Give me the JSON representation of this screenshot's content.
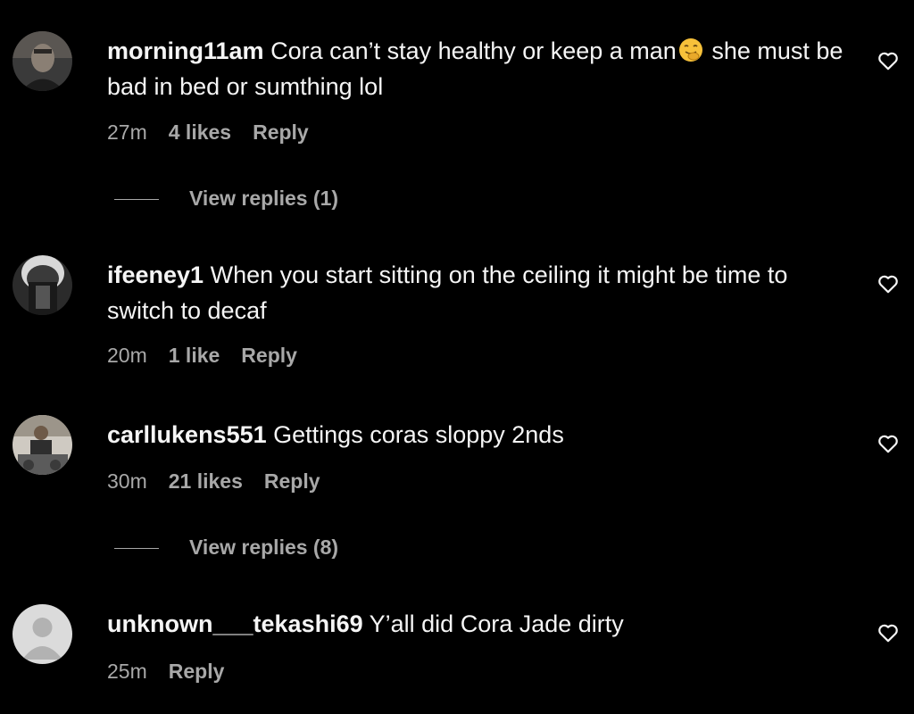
{
  "comments": [
    {
      "username": "morning11am",
      "text_before_emoji": "Cora can’t stay healthy or keep a man",
      "emoji": "face-with-hand-over-mouth-icon",
      "text_after_emoji": "she must be bad in bed or sumthing lol",
      "time": "27m",
      "likes": "4 likes",
      "reply": "Reply",
      "view_replies": "View replies (1)"
    },
    {
      "username": "ifeeney1",
      "text": "When you start sitting on the ceiling it might be time to switch to decaf",
      "time": "20m",
      "likes": "1 like",
      "reply": "Reply"
    },
    {
      "username": "carllukens551",
      "text": "Gettings coras sloppy 2nds",
      "time": "30m",
      "likes": "21 likes",
      "reply": "Reply",
      "view_replies": "View replies (8)"
    },
    {
      "username": "unknown___tekashi69",
      "text": "Y’all did Cora Jade dirty",
      "time": "25m",
      "reply": "Reply"
    }
  ],
  "colors": {
    "background": "#000000",
    "primary_text": "#f5f5f5",
    "secondary_text": "#a8a8a8"
  },
  "icons": {
    "like": "heart-outline-icon",
    "default_avatar": "default-avatar-icon"
  }
}
